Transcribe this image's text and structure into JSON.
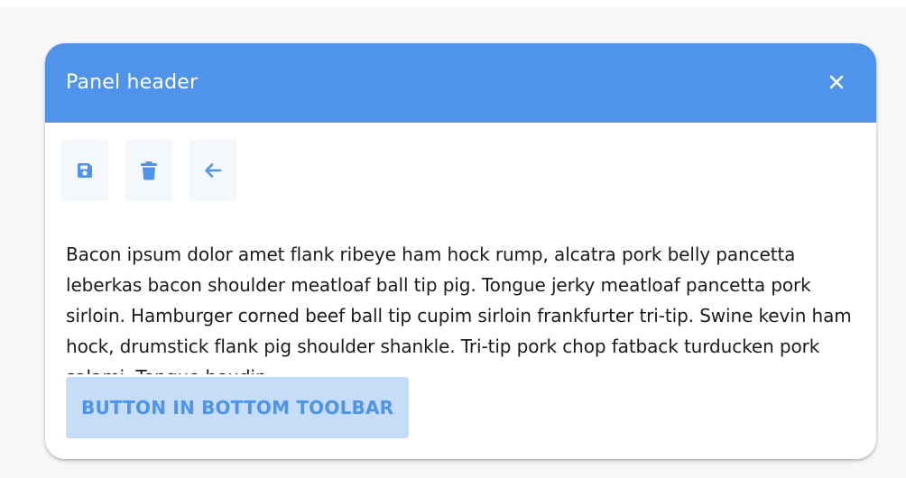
{
  "panel": {
    "header_title": "Panel header",
    "close_icon": "close-icon",
    "toolbar": {
      "buttons": [
        {
          "icon": "save-icon"
        },
        {
          "icon": "trash-icon"
        },
        {
          "icon": "arrow-left-icon"
        }
      ]
    },
    "content": {
      "text": "Bacon ipsum dolor amet flank ribeye ham hock rump, alcatra pork belly pancetta leberkas bacon shoulder meatloaf ball tip pig. Tongue jerky meatloaf pancetta pork sirloin. Hamburger corned beef ball tip cupim sirloin frankfurter tri-tip. Swine kevin ham hock, drumstick flank pig shoulder shankle. Tri-tip pork chop fatback turducken pork salami. Tongue boudin"
    },
    "bottom_toolbar": {
      "button_label": "BUTTON IN BOTTOM TOOLBAR"
    }
  },
  "colors": {
    "accent": "#4f94ea",
    "header_bg": "#4f94ea",
    "bottom_button_bg": "#c6dcf7",
    "tool_button_bg": "#f4f7fb",
    "page_bg": "#f7f7f8"
  }
}
